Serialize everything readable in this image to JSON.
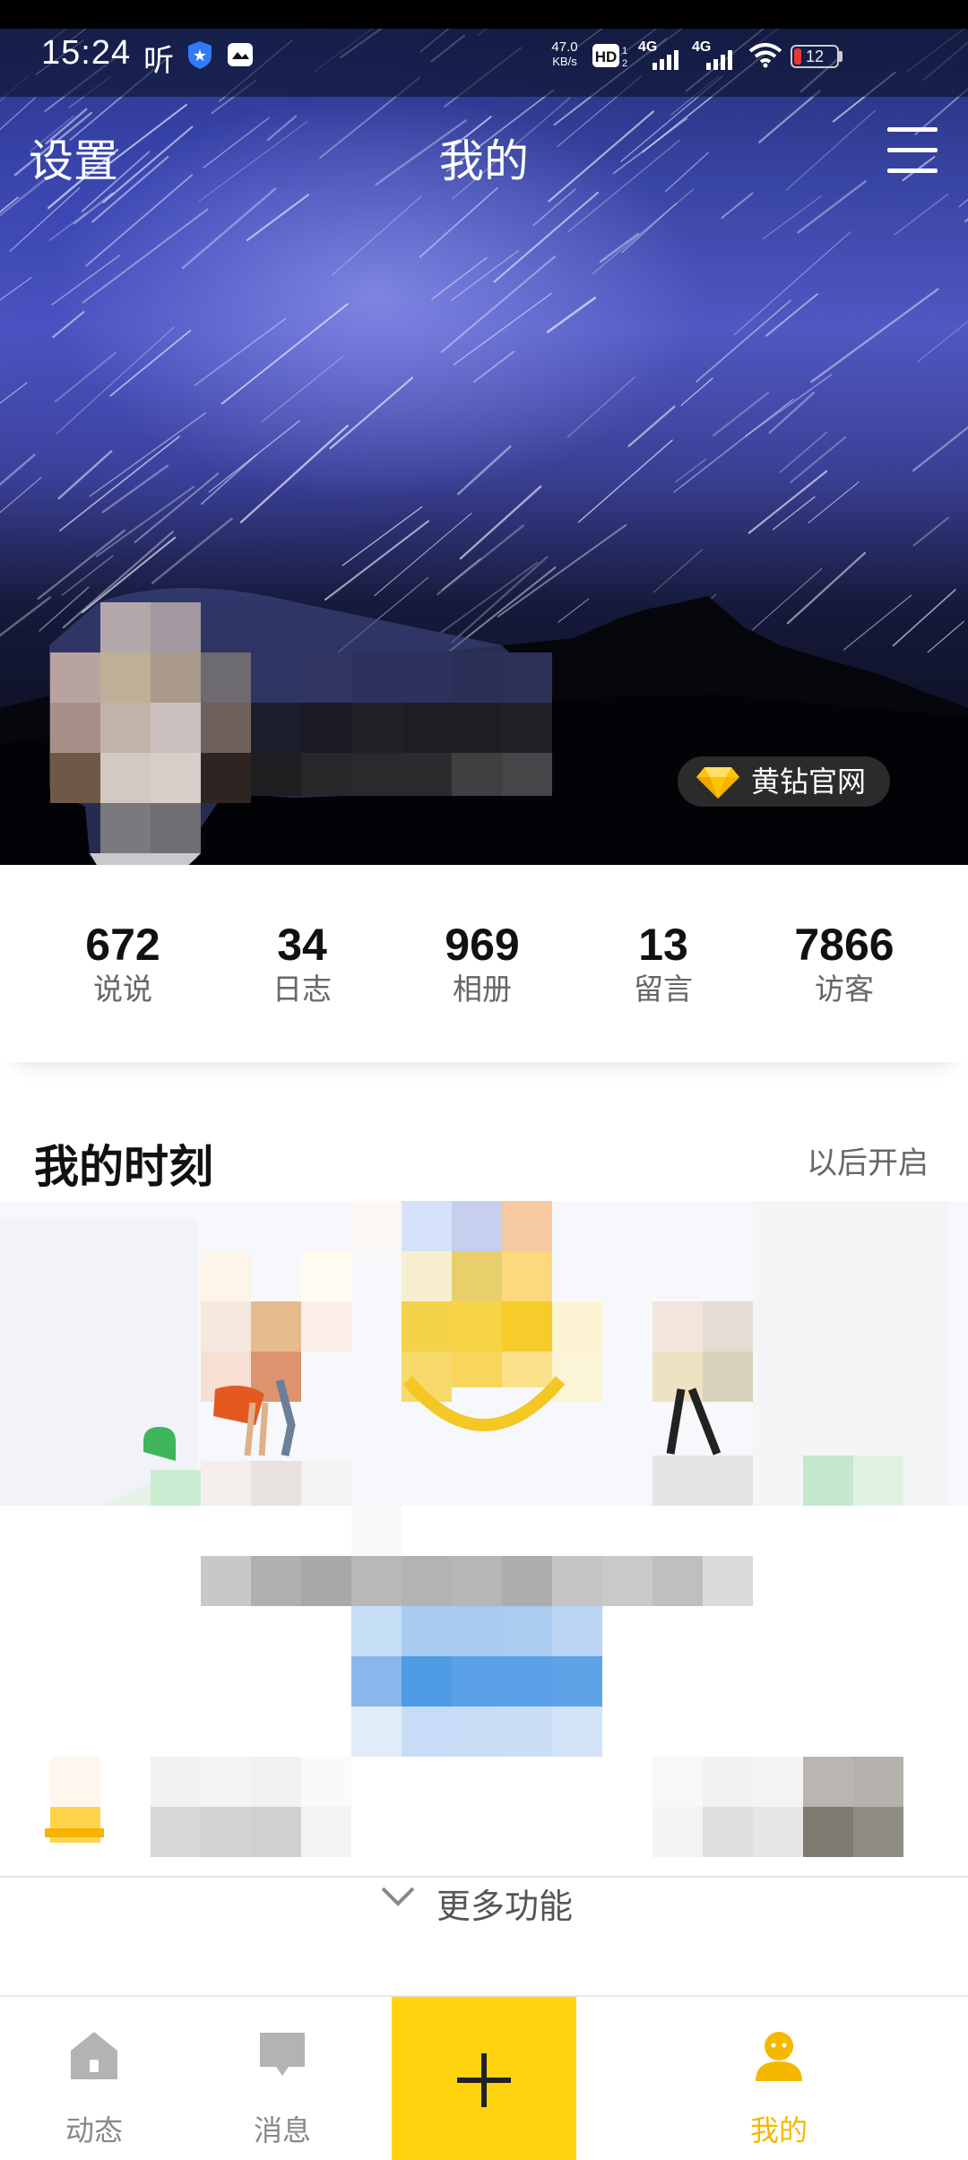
{
  "status_bar": {
    "time": "15:24",
    "net_speed_value": "47.0",
    "net_speed_unit": "KB/s",
    "signal_1": "4G",
    "signal_2": "4G",
    "battery": "12",
    "icons": [
      "listen-icon",
      "shield-app-icon",
      "image-app-icon",
      "hd-voice-icon",
      "signal-icon",
      "wifi-icon",
      "battery-icon"
    ],
    "listen_glyph": "听",
    "hd_text": "HD"
  },
  "nav": {
    "settings": "设置",
    "title": "我的",
    "menu_icon": "menu-icon"
  },
  "vip_badge": {
    "label": "黄钻官网",
    "icon": "yellow-diamond-icon"
  },
  "stats": [
    {
      "value": "672",
      "label": "说说"
    },
    {
      "value": "34",
      "label": "日志"
    },
    {
      "value": "969",
      "label": "相册"
    },
    {
      "value": "13",
      "label": "留言"
    },
    {
      "value": "7866",
      "label": "访客"
    }
  ],
  "moments": {
    "title": "我的时刻",
    "later": "以后开启"
  },
  "more_features": "更多功能",
  "tabs": [
    {
      "label": "动态",
      "icon": "home-icon"
    },
    {
      "label": "消息",
      "icon": "message-icon"
    },
    {
      "label": "",
      "icon": "plus-icon"
    },
    {
      "label": "我的",
      "icon": "profile-icon"
    }
  ],
  "colors": {
    "accent_yellow": "#FFD30E",
    "active_tab": "#F5B800",
    "inactive_tab": "#888888"
  }
}
